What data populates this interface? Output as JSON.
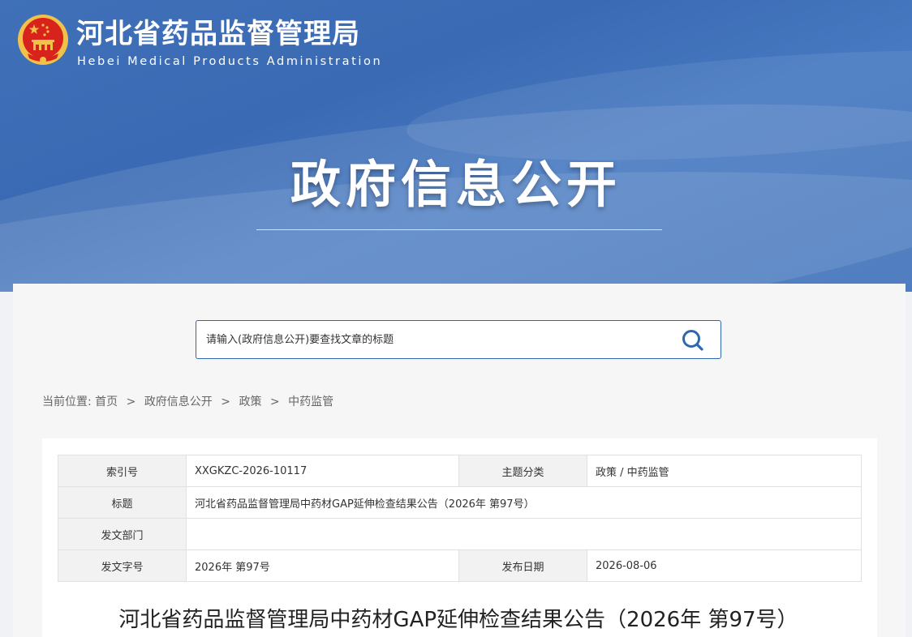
{
  "header": {
    "site_name": "河北省药品监督管理局",
    "site_name_en": "Hebei Medical Products Administration",
    "section_title": "政府信息公开",
    "logo_icon": "national-emblem-icon"
  },
  "search": {
    "placeholder": "请输入(政府信息公开)要查找文章的标题",
    "icon": "search-icon",
    "accent_color": "#2f66b2"
  },
  "breadcrumb": {
    "prefix": "当前位置:",
    "items": [
      "首页",
      "政府信息公开",
      "政策",
      "中药监管"
    ],
    "separator": ">"
  },
  "meta_table": {
    "index_label": "索引号",
    "index_value": "XXGKZC-2026-10117",
    "topic_label": "主题分类",
    "topic_value": "政策 / 中药监管",
    "title_label": "标题",
    "title_value": "河北省药品监督管理局中药材GAP延伸检查结果公告（2026年 第97号）",
    "dept_label": "发文部门",
    "dept_value": "",
    "docno_label": "发文字号",
    "docno_value": "2026年 第97号",
    "date_label": "发布日期",
    "date_value": "2026-08-06"
  },
  "article": {
    "title": "河北省药品监督管理局中药材GAP延伸检查结果公告（2026年 第97号）"
  },
  "colors": {
    "banner_blue": "#3f70b8",
    "emblem_red": "#d7231b",
    "emblem_gold": "#f2c14a"
  }
}
